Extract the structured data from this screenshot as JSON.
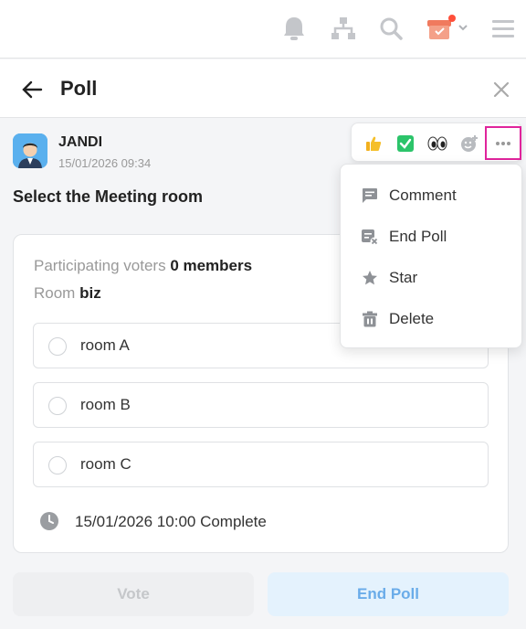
{
  "topbar": {
    "icons": [
      "bell-icon",
      "org-chart-icon",
      "search-icon",
      "box-icon",
      "menu-icon"
    ],
    "notification_color": "#ff4f3a"
  },
  "header": {
    "title": "Poll"
  },
  "message": {
    "author": "JANDI",
    "time": "15/01/2026 09:34",
    "poll_title": "Select the Meeting room"
  },
  "reactions": {
    "items": [
      "thumbs-up-icon",
      "check-icon",
      "eyes-icon",
      "add-emoji-icon"
    ],
    "highlight_color": "#e0249c"
  },
  "poll": {
    "voters_label": "Participating voters",
    "voters_value": "0 members",
    "room_label": "Room",
    "room_value": "biz",
    "options": [
      {
        "label": "room A"
      },
      {
        "label": "room B"
      },
      {
        "label": "room C"
      }
    ],
    "deadline": "15/01/2026 10:00 Complete"
  },
  "buttons": {
    "vote": "Vote",
    "end_poll": "End Poll"
  },
  "menu": {
    "items": [
      {
        "label": "Comment",
        "icon": "comment-icon"
      },
      {
        "label": "End Poll",
        "icon": "end-poll-icon"
      },
      {
        "label": "Star",
        "icon": "star-icon"
      },
      {
        "label": "Delete",
        "icon": "trash-icon"
      }
    ]
  }
}
